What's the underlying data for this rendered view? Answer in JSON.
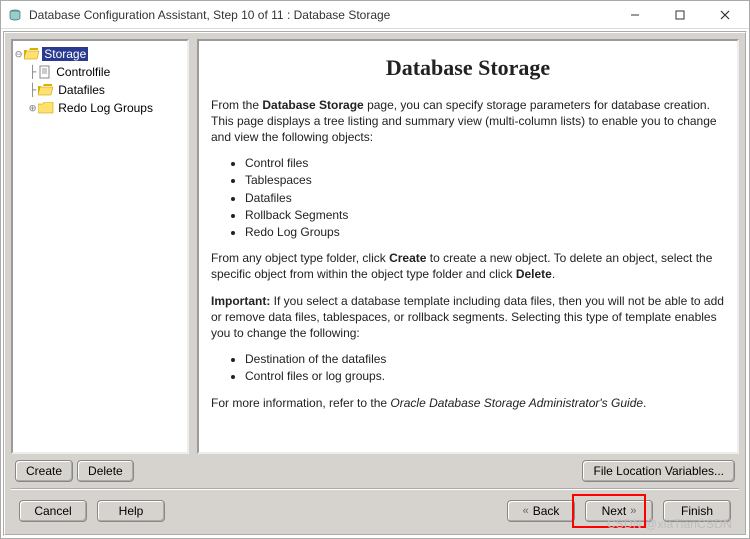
{
  "window": {
    "title": "Database Configuration Assistant, Step 10 of 11 : Database Storage"
  },
  "tree": {
    "items": [
      {
        "label": "Storage",
        "selected": true,
        "icon": "folder-open"
      },
      {
        "label": "Controlfile",
        "icon": "doc"
      },
      {
        "label": "Datafiles",
        "icon": "folder-open"
      },
      {
        "label": "Redo Log Groups",
        "icon": "folder-closed"
      }
    ]
  },
  "desc": {
    "heading": "Database Storage",
    "p1_a": "From the ",
    "p1_b": "Database Storage",
    "p1_c": " page, you can specify storage parameters for database creation. This page displays a tree listing and summary view (multi-column lists) to enable you to change and view the following objects:",
    "list1": [
      "Control files",
      "Tablespaces",
      "Datafiles",
      "Rollback Segments",
      "Redo Log Groups"
    ],
    "p2_a": "From any object type folder, click ",
    "p2_b": "Create",
    "p2_c": " to create a new object. To delete an object, select the specific object from within the object type folder and click ",
    "p2_d": "Delete",
    "p2_e": ".",
    "p3_a": "Important:",
    "p3_b": " If you select a database template including data files, then you will not be able to add or remove data files, tablespaces, or rollback segments. Selecting this type of template enables you to change the following:",
    "list2": [
      "Destination of the datafiles",
      "Control files or log groups."
    ],
    "p4_a": "For more information, refer to the ",
    "p4_b": "Oracle Database Storage Administrator's Guide",
    "p4_c": "."
  },
  "buttons": {
    "create": "Create",
    "delete": "Delete",
    "fileLocation": "File Location Variables...",
    "cancel": "Cancel",
    "help": "Help",
    "back": "Back",
    "next": "Next",
    "finish": "Finish"
  },
  "watermark": "CSDN @xiaTianCSDN"
}
